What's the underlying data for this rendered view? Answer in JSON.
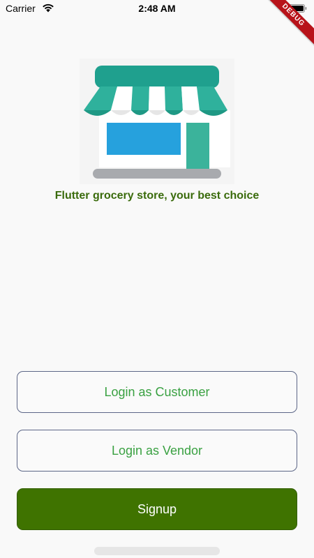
{
  "status_bar": {
    "carrier": "Carrier",
    "time": "2:48 AM",
    "wifi_icon": "wifi-icon",
    "battery_icon": "battery-icon"
  },
  "debug_banner": {
    "label": "DEBUG",
    "color": "#b8131a"
  },
  "hero": {
    "illustration_icon": "store-front-icon",
    "tagline": "Flutter grocery store, your best choice"
  },
  "actions": {
    "login_customer": "Login as Customer",
    "login_vendor": "Login as Vendor",
    "signup": "Signup"
  },
  "colors": {
    "tagline": "#3a6b0c",
    "outline_text": "#3aa142",
    "outline_border": "#5c6687",
    "signup_bg": "#3f7300",
    "awning": "#2aa48c",
    "window": "#26a1dd",
    "door": "#3bb39b"
  }
}
